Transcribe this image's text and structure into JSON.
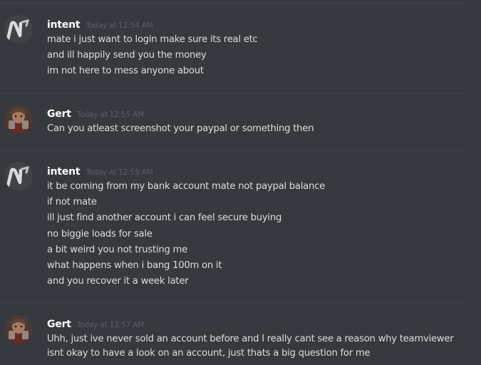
{
  "messages": [
    {
      "username": "intent",
      "timestamp": "Today at 12:54 AM",
      "avatar_icon": "intent-logo-avatar",
      "lines": [
        "mate i just want to login make sure its real etc",
        "and ill happily send you the money",
        "im not here to mess anyone about"
      ]
    },
    {
      "username": "Gert",
      "timestamp": "Today at 12:55 AM",
      "avatar_icon": "gert-character-avatar",
      "lines": [
        "Can you atleast screenshot your paypal or something then"
      ]
    },
    {
      "username": "intent",
      "timestamp": "Today at 12:55 AM",
      "avatar_icon": "intent-logo-avatar",
      "lines": [
        "it be coming from my bank account mate not paypal balance",
        "if not mate",
        "ill just find another account i can feel secure buying",
        "no biggie loads for sale",
        "a bit weird you not trusting me",
        "what happens when i bang 100m on it",
        "and you recover it a week later"
      ]
    },
    {
      "username": "Gert",
      "timestamp": "Today at 12:57 AM",
      "avatar_icon": "gert-character-avatar",
      "lines": [
        "Uhh, just ive never sold an account before and I really cant see a reason why teamviewer",
        "isnt okay to have a look on an account, just thats a big question for me"
      ]
    }
  ],
  "colors": {
    "background": "#36393e",
    "username": "#ffffff",
    "timestamp": "#5b5e63",
    "message_text": "#dcddde",
    "divider": "#3f4247"
  }
}
